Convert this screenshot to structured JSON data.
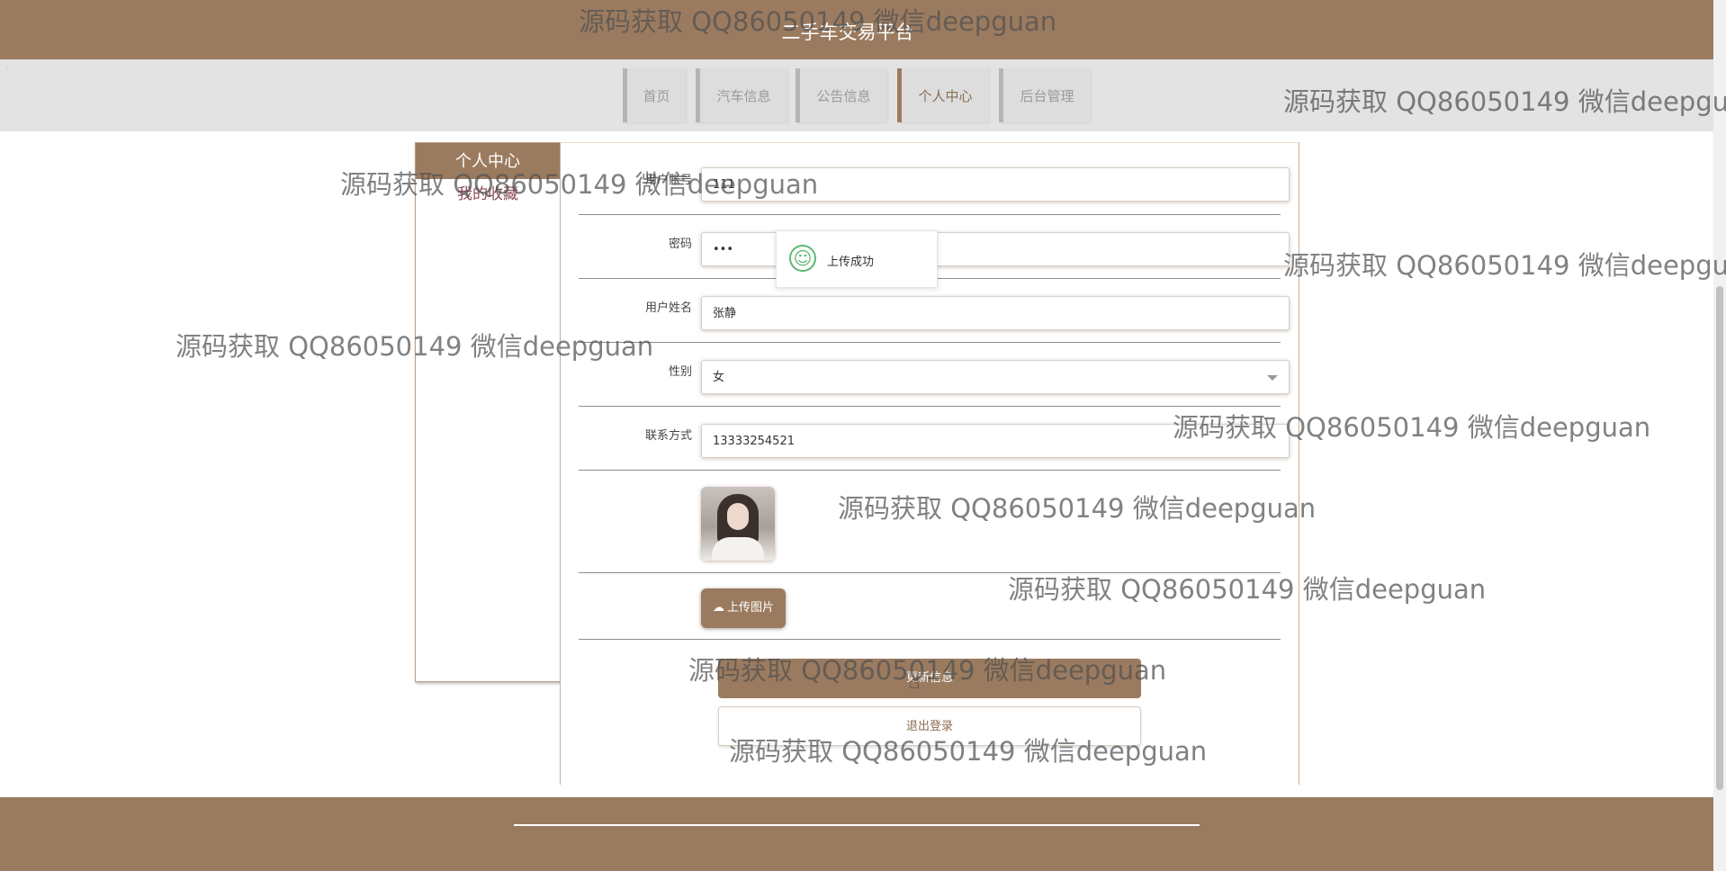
{
  "header": {
    "site_title": "二手车交易平台"
  },
  "nav": {
    "items": [
      {
        "label": "首页",
        "active": false
      },
      {
        "label": "汽车信息",
        "active": false
      },
      {
        "label": "公告信息",
        "active": false
      },
      {
        "label": "个人中心",
        "active": true
      },
      {
        "label": "后台管理",
        "active": false
      }
    ]
  },
  "sidebar": {
    "title": "个人中心",
    "links": [
      "我的收藏"
    ]
  },
  "form": {
    "username": {
      "label": "用户账号",
      "value": "111"
    },
    "password": {
      "label": "密码",
      "value": "•••"
    },
    "name": {
      "label": "用户姓名",
      "value": "张静"
    },
    "gender": {
      "label": "性别",
      "value": "女"
    },
    "phone": {
      "label": "联系方式",
      "value": "13333254521"
    },
    "upload_button": "上传图片",
    "update_button": "更新信息",
    "logout_button": "退出登录"
  },
  "toast": {
    "message": "上传成功",
    "icon": "smile-icon",
    "color": "#5fb878"
  },
  "watermark": {
    "text": "源码获取 QQ86050149 微信deepguan"
  },
  "colors": {
    "brand": "#9b7b5f",
    "nav_bg": "#e3e3e3",
    "link": "#8b4a55"
  }
}
